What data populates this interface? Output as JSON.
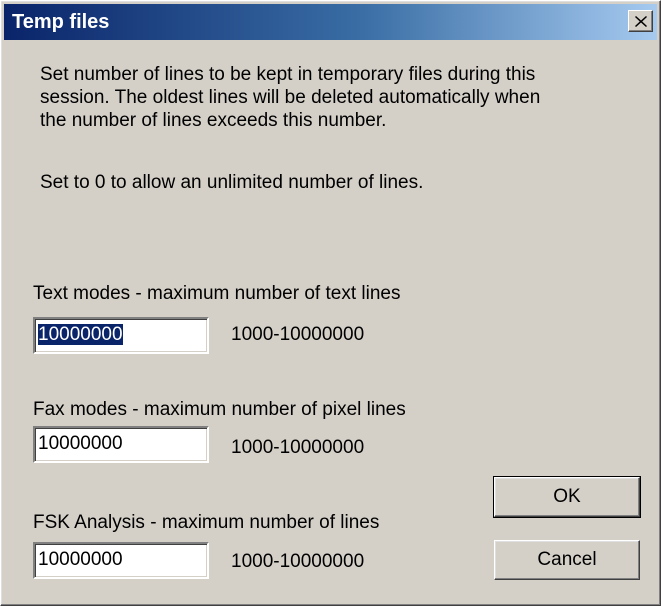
{
  "window": {
    "title": "Temp files",
    "close_icon": "close-icon"
  },
  "description": {
    "paragraph1": "Set number of lines to be kept in temporary files during this\nsession.  The oldest lines will be deleted automatically when\nthe number of lines exceeds this number.",
    "paragraph2": "Set to 0 to allow an unlimited number of lines."
  },
  "fields": [
    {
      "label": "Text modes - maximum number of text lines",
      "value": "10000000",
      "range": "1000-10000000",
      "selected": true
    },
    {
      "label": "Fax modes - maximum number of pixel lines",
      "value": "10000000",
      "range": "1000-10000000",
      "selected": false
    },
    {
      "label": "FSK Analysis - maximum number of lines",
      "value": "10000000",
      "range": "1000-10000000",
      "selected": false
    }
  ],
  "buttons": {
    "ok_label": "OK",
    "cancel_label": "Cancel"
  },
  "colors": {
    "titlebar_start": "#0a246a",
    "titlebar_end": "#a6caf0",
    "face": "#d4d0c8",
    "selection": "#0a246a"
  }
}
